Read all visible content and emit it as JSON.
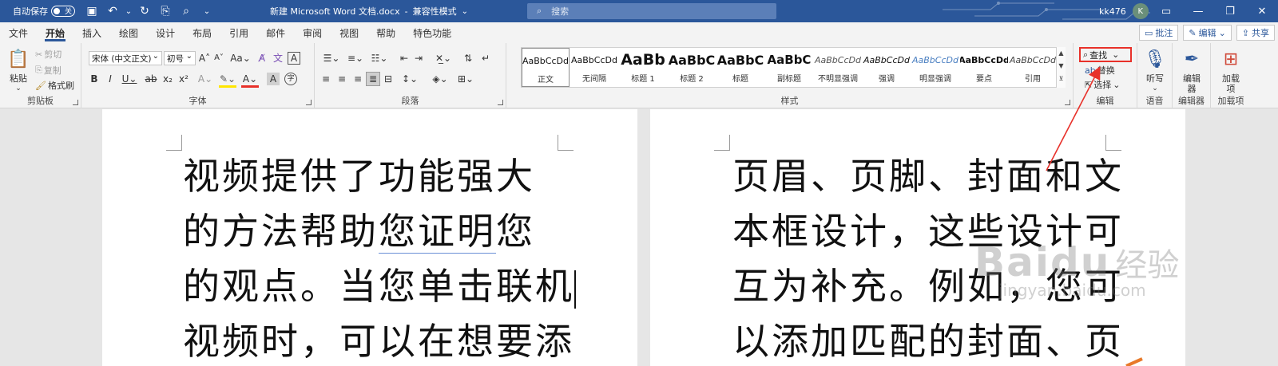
{
  "titlebar": {
    "autosave_label": "自动保存",
    "autosave_state": "关",
    "doc_title": "新建 Microsoft Word 文档.docx",
    "separator": "-",
    "compat_mode": "兼容性模式",
    "search_placeholder": "搜索",
    "user_name": "kk476",
    "avatar_initial": "K",
    "bg_color": "#2b579a"
  },
  "tabs": [
    "文件",
    "开始",
    "插入",
    "绘图",
    "设计",
    "布局",
    "引用",
    "邮件",
    "审阅",
    "视图",
    "帮助",
    "特色功能"
  ],
  "active_tab": "开始",
  "tab_buttons": {
    "comments": "批注",
    "editing": "编辑",
    "share": "共享"
  },
  "clipboard": {
    "paste": "粘贴",
    "cut": "剪切",
    "copy": "复制",
    "format_painter": "格式刷",
    "label": "剪贴板"
  },
  "font": {
    "family": "宋体 (中文正文)",
    "size": "初号",
    "case_btn": "Aa",
    "label": "字体"
  },
  "paragraph": {
    "label": "段落"
  },
  "styles": {
    "items": [
      {
        "preview": "AaBbCcDd",
        "name": "正文"
      },
      {
        "preview": "AaBbCcDd",
        "name": "无间隔"
      },
      {
        "preview": "AaBb",
        "name": "标题 1"
      },
      {
        "preview": "AaBbC",
        "name": "标题 2"
      },
      {
        "preview": "AaBbC",
        "name": "标题"
      },
      {
        "preview": "AaBbC",
        "name": "副标题"
      },
      {
        "preview": "AaBbCcDd",
        "name": "不明显强调"
      },
      {
        "preview": "AaBbCcDd",
        "name": "强调"
      },
      {
        "preview": "AaBbCcDd",
        "name": "明显强调"
      },
      {
        "preview": "AaBbCcDd",
        "name": "要点"
      },
      {
        "preview": "AaBbCcDd",
        "name": "引用"
      }
    ],
    "label": "样式"
  },
  "editing": {
    "find": "查找",
    "replace": "替换",
    "select": "选择",
    "label": "编辑"
  },
  "voice": {
    "dictate": "听写",
    "label": "语音"
  },
  "editor": {
    "button": "编辑器",
    "label": "编辑器"
  },
  "addins": {
    "button": "加载项",
    "label": "加载项"
  },
  "page1": {
    "lines": [
      "视频提供了功能强大",
      "的方法帮助",
      "您证明",
      "您",
      "的观点。当您单击联机",
      "视频时，可以在想要添"
    ]
  },
  "page2": {
    "lines": [
      "页眉、页脚、封面和文",
      "本框设计，这些设计可",
      "互为补充。例如，您可",
      "以添加匹配的封面、页"
    ]
  },
  "watermark": {
    "brand": "Baidu",
    "brand_cn": "经验",
    "url": "jingyan.baidu.com"
  },
  "highlight_color": "#e8312a"
}
